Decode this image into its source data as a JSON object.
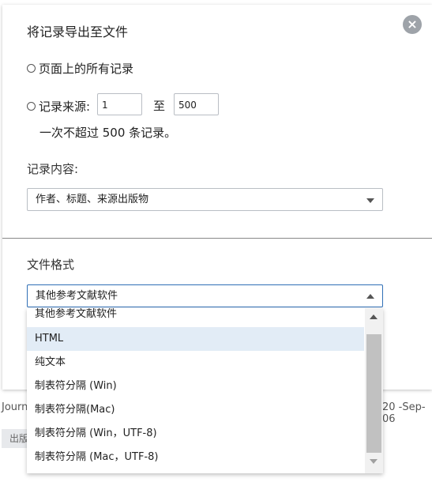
{
  "background": {
    "journal_text": "Journ",
    "date_text": "20 -Sep-06",
    "button_label": "出版"
  },
  "dialog": {
    "title": "将记录导出至文件",
    "close_symbol": "×",
    "option_all_records": "页面上的所有记录",
    "option_record_source": "记录来源:",
    "range_from": "1",
    "range_to_label": "至",
    "range_to": "500",
    "limit_hint": "一次不超过 500 条记录。",
    "content_label": "记录内容:",
    "content_selected": "作者、标题、来源出版物",
    "format_label": "文件格式",
    "format_selected": "其他参考文献软件"
  },
  "format_options": [
    "其他参考文献软件",
    "HTML",
    "纯文本",
    "制表符分隔 (Win)",
    "制表符分隔(Mac)",
    "制表符分隔 (Win，UTF-8)",
    "制表符分隔 (Mac，UTF-8)"
  ],
  "highlighted_option": "HTML",
  "colors": {
    "highlight": "#e2ecf6",
    "focus_border": "#2f6fb6",
    "close_button": "#9ea3a9"
  }
}
